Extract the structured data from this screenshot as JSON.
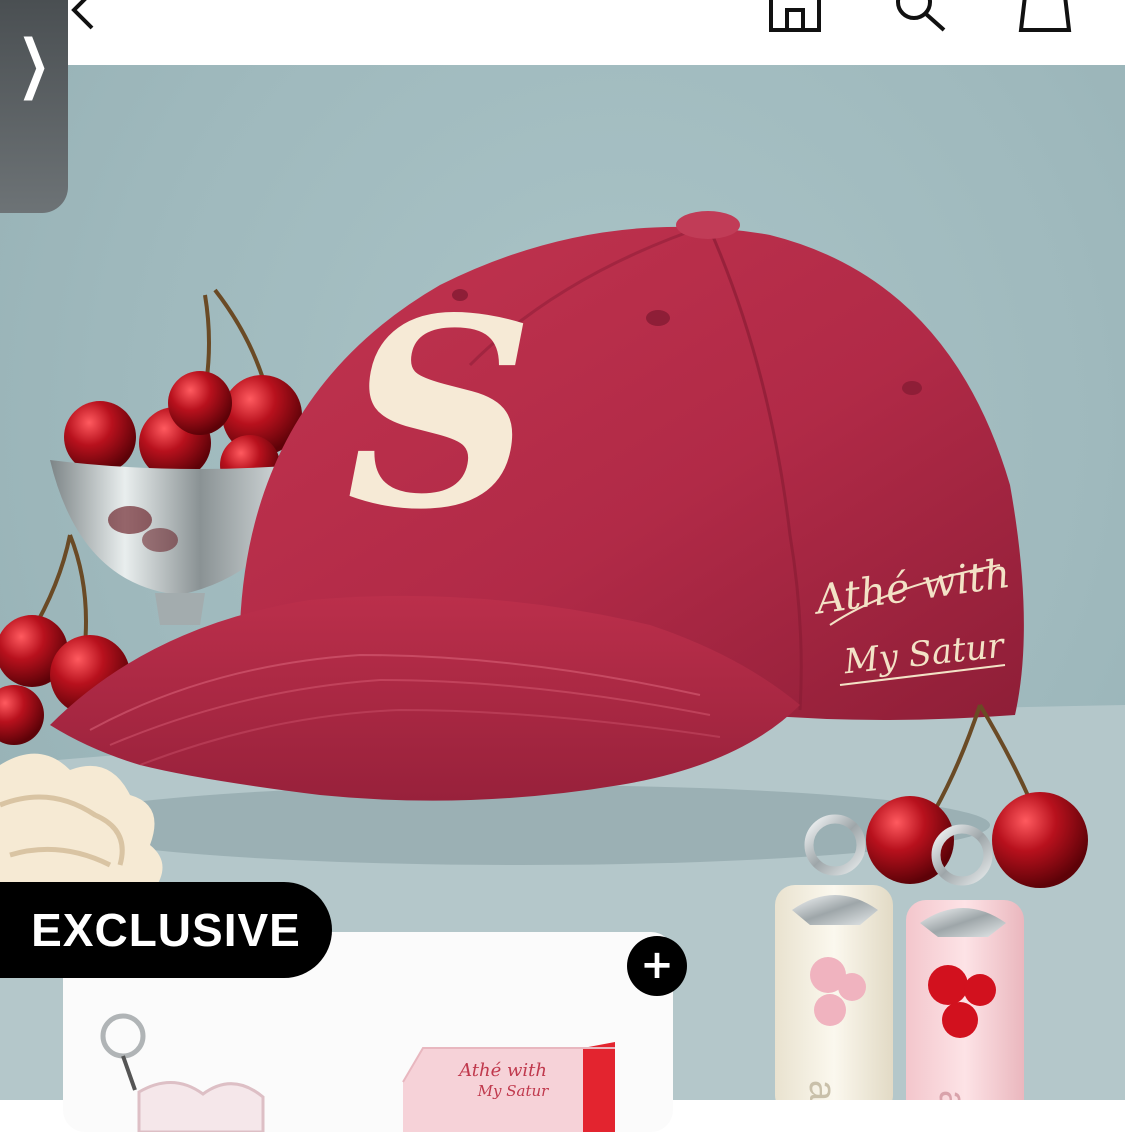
{
  "top_nav": {
    "back_icon": "chevron-left-icon",
    "home_icon": "home-icon",
    "search_icon": "search-icon",
    "bag_icon": "shopping-bag-icon"
  },
  "drawer_tab": {
    "label": "❯"
  },
  "hero": {
    "cap_letter": "S",
    "cap_script_line1": "Athé with",
    "cap_script_line2": "My Satur",
    "box_script_line1": "Athé with",
    "box_script_line2": "My Satur",
    "tube_text": "at"
  },
  "promo": {
    "badge_label": "EXCLUSIVE",
    "add_button_label": "+"
  },
  "colors": {
    "cap_red": "#b12a47",
    "background_teal": "#a3bec1",
    "badge_black": "#000000",
    "cherry_red": "#a8101c"
  }
}
